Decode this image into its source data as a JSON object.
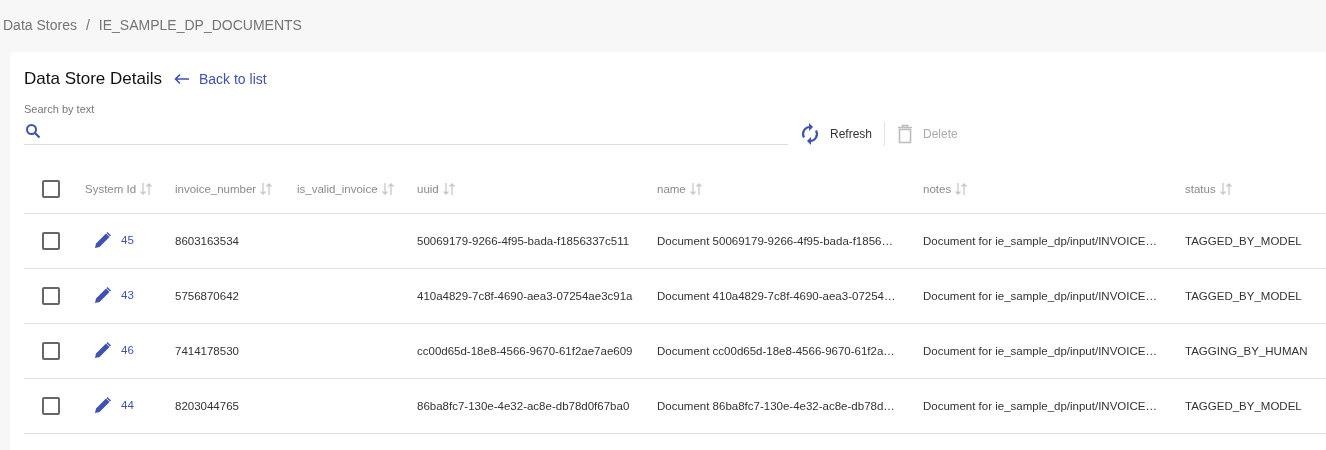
{
  "breadcrumb": [
    {
      "label": "Data Stores"
    },
    {
      "label": "IE_SAMPLE_DP_DOCUMENTS"
    }
  ],
  "breadcrumb_separator": "/",
  "title": "Data Store Details",
  "back_link": "Back to list",
  "search": {
    "label": "Search by text"
  },
  "toolbar": [
    {
      "kind": "refresh",
      "label": "Refresh",
      "disabled": false
    },
    {
      "kind": "delete",
      "label": "Delete",
      "disabled": true
    }
  ],
  "table": {
    "select_all_checked": false,
    "columns": [
      "System Id",
      "invoice_number",
      "is_valid_invoice",
      "uuid",
      "name",
      "notes",
      "status"
    ],
    "rows": [
      {
        "checked": false,
        "system_id": "45",
        "invoice_number": "8603163534",
        "is_valid_invoice": "",
        "uuid": "50069179-9266-4f95-bada-f1856337c511",
        "name": "Document 50069179-9266-4f95-bada-f1856…",
        "notes": "Document for ie_sample_dp/input/INVOICE…",
        "status": "TAGGED_BY_MODEL"
      },
      {
        "checked": false,
        "system_id": "43",
        "invoice_number": "5756870642",
        "is_valid_invoice": "",
        "uuid": "410a4829-7c8f-4690-aea3-07254ae3c91a",
        "name": "Document 410a4829-7c8f-4690-aea3-07254…",
        "notes": "Document for ie_sample_dp/input/INVOICE…",
        "status": "TAGGED_BY_MODEL"
      },
      {
        "checked": false,
        "system_id": "46",
        "invoice_number": "7414178530",
        "is_valid_invoice": "",
        "uuid": "cc00d65d-18e8-4566-9670-61f2ae7ae609",
        "name": "Document cc00d65d-18e8-4566-9670-61f2a…",
        "notes": "Document for ie_sample_dp/input/INVOICE…",
        "status": "TAGGING_BY_HUMAN"
      },
      {
        "checked": false,
        "system_id": "44",
        "invoice_number": "8203044765",
        "is_valid_invoice": "",
        "uuid": "86ba8fc7-130e-4e32-ac8e-db78d0f67ba0",
        "name": "Document 86ba8fc7-130e-4e32-ac8e-db78d…",
        "notes": "Document for ie_sample_dp/input/INVOICE…",
        "status": "TAGGED_BY_MODEL"
      }
    ]
  }
}
